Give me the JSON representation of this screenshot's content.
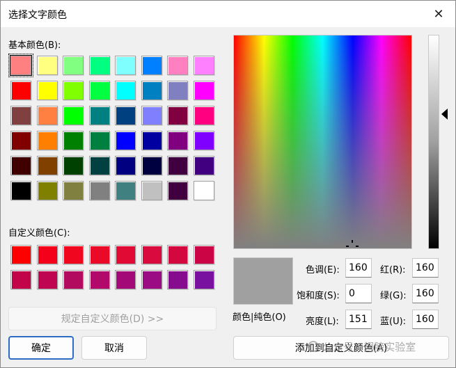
{
  "window": {
    "title": "选择文字颜色",
    "close_glyph": "✕"
  },
  "basic": {
    "label": "基本颜色(B):",
    "colors": [
      "#ff8080",
      "#ffff80",
      "#80ff80",
      "#00ff80",
      "#80ffff",
      "#0080ff",
      "#ff80c0",
      "#ff80ff",
      "#ff0000",
      "#ffff00",
      "#80ff00",
      "#00ff40",
      "#00ffff",
      "#0080c0",
      "#8080c0",
      "#ff00ff",
      "#804040",
      "#ff8040",
      "#00ff00",
      "#008080",
      "#004080",
      "#8080ff",
      "#800040",
      "#ff0080",
      "#800000",
      "#ff8000",
      "#008000",
      "#008040",
      "#0000ff",
      "#0000a0",
      "#800080",
      "#8000ff",
      "#400000",
      "#804000",
      "#004000",
      "#004040",
      "#000080",
      "#000040",
      "#400040",
      "#400080",
      "#000000",
      "#808000",
      "#808040",
      "#808080",
      "#408080",
      "#c0c0c0",
      "#400040",
      "#ffffff"
    ]
  },
  "custom": {
    "label": "自定义颜色(C):",
    "colors": [
      "#ff0000",
      "#f5001a",
      "#f0061f",
      "#ea0a28",
      "#e00a35",
      "#d80a3e",
      "#d3083e",
      "#cb0545",
      "#c20448",
      "#bf0551",
      "#b20a5e",
      "#b20a6a",
      "#a30a78",
      "#9b0c84",
      "#860c8e",
      "#7a10a0"
    ]
  },
  "buttons": {
    "define_custom": "规定自定义颜色(D) >>",
    "ok": "确定",
    "cancel": "取消",
    "add_custom": "添加到自定义颜色(A)"
  },
  "preview": {
    "label": "颜色|纯色(O)",
    "color": "#a0a0a0"
  },
  "fields": {
    "hue": {
      "label": "色调(E):",
      "value": "160"
    },
    "sat": {
      "label": "饱和度(S):",
      "value": "0"
    },
    "lum": {
      "label": "亮度(L):",
      "value": "151"
    },
    "red": {
      "label": "红(R):",
      "value": "160"
    },
    "green": {
      "label": "绿(G):",
      "value": "160"
    },
    "blue": {
      "label": "蓝(U):",
      "value": "160"
    }
  },
  "watermark": "公众号 · 翅膀实验室"
}
